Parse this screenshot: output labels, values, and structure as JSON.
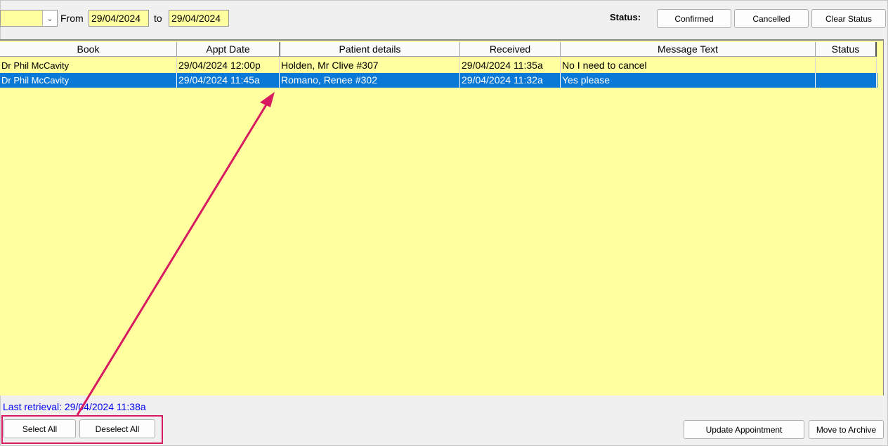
{
  "toolbar": {
    "filter_value": "",
    "from_label": "From",
    "from_date": "29/04/2024",
    "to_label": "to",
    "to_date": "29/04/2024",
    "status_label": "Status:",
    "confirmed_label": "Confirmed",
    "cancelled_label": "Cancelled",
    "clear_status_label": "Clear Status"
  },
  "table": {
    "headers": [
      "Book",
      "Appt Date",
      "Patient details",
      "Received",
      "Message Text",
      "Status"
    ],
    "rows": [
      {
        "book": "Dr Phil McCavity",
        "appt_date": "29/04/2024 12:00p",
        "patient": "Holden, Mr Clive #307",
        "received": "29/04/2024 11:35a",
        "message": "No I need to cancel",
        "status": "",
        "selected": false
      },
      {
        "book": "Dr Phil McCavity",
        "appt_date": "29/04/2024 11:45a",
        "patient": "Romano, Renee #302",
        "received": "29/04/2024 11:32a",
        "message": "Yes please",
        "status": "",
        "selected": true
      }
    ]
  },
  "footer": {
    "last_retrieval": "Last retrieval: 29/04/2024 11:38a",
    "select_all_label": "Select All",
    "deselect_all_label": "Deselect All",
    "update_appointment_label": "Update Appointment",
    "move_to_archive_label": "Move to Archive"
  },
  "colors": {
    "grid_background": "#ffff9f",
    "selection": "#0a78d7",
    "annotation": "#d81b60",
    "link_text": "#0000ee"
  },
  "icons": {
    "combo_dropdown": "chevron-down-icon"
  }
}
